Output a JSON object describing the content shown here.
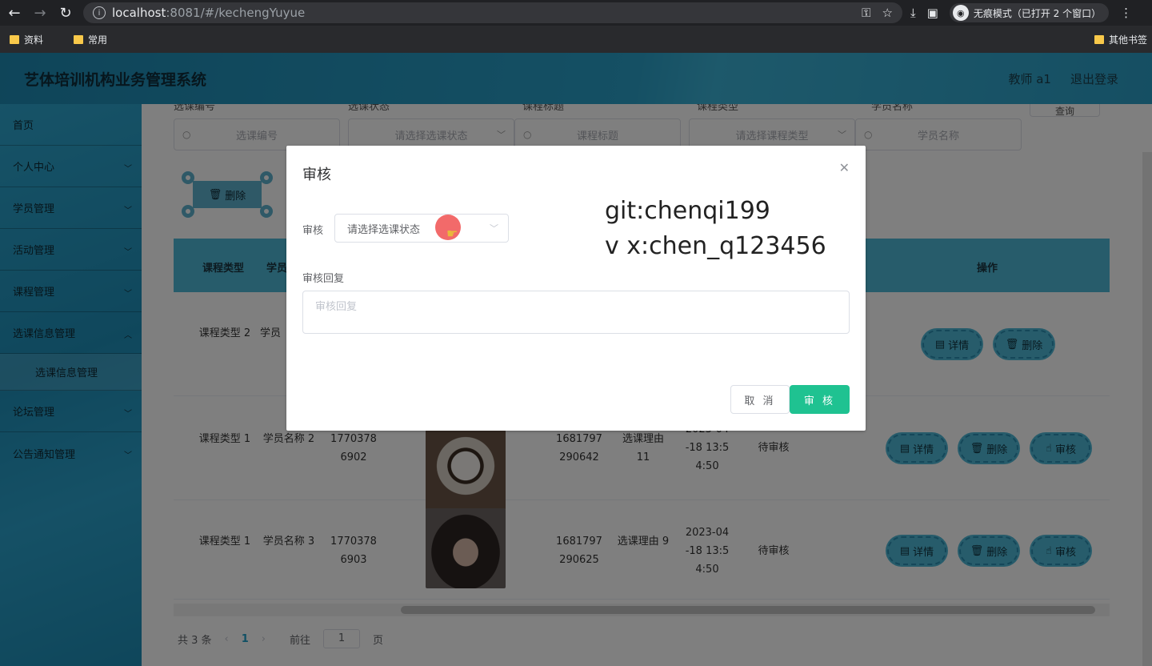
{
  "browser": {
    "url_host": "localhost",
    "url_path": ":8081/#/kechengYuyue",
    "incognito_label": "无痕模式（已打开 2 个窗口）",
    "bookmarks": [
      "资料",
      "常用"
    ],
    "other_bookmarks": "其他书签"
  },
  "header": {
    "title": "艺体培训机构业务管理系统",
    "user": "教师 a1",
    "logout": "退出登录"
  },
  "sidebar": {
    "items": [
      {
        "label": "首页"
      },
      {
        "label": "个人中心"
      },
      {
        "label": "学员管理"
      },
      {
        "label": "活动管理"
      },
      {
        "label": "课程管理"
      },
      {
        "label": "选课信息管理"
      }
    ],
    "sub_item": "选课信息管理",
    "items_after": [
      {
        "label": "论坛管理"
      },
      {
        "label": "公告通知管理"
      }
    ]
  },
  "search": {
    "labels": [
      "选课编号",
      "选课状态",
      "课程标题",
      "课程类型",
      "学员名称"
    ],
    "placeholders": [
      "选课编号",
      "请选择选课状态",
      "课程标题",
      "请选择课程类型",
      "学员名称"
    ],
    "query_label": "查询"
  },
  "toolbar": {
    "bulk_delete": "删除"
  },
  "table": {
    "headers": [
      "课程类型",
      "学员",
      "操作"
    ],
    "rows": [
      {
        "type": "课程类型 2",
        "student": "学员",
        "phone": "",
        "code": "",
        "reason": "",
        "time": "",
        "status": ""
      },
      {
        "type": "课程类型 1",
        "student": "学员名称 2",
        "phone": "1770378 6902",
        "code": "1681797 290642",
        "reason": "选课理由 11",
        "time": "2023-04 -18 13:5 4:50",
        "status": "待审核"
      },
      {
        "type": "课程类型 1",
        "student": "学员名称 3",
        "phone": "1770378 6903",
        "code": "1681797 290625",
        "reason": "选课理由 9",
        "time": "2023-04 -18 13:5 4:50",
        "status": "待审核"
      }
    ],
    "actions": {
      "detail": "详情",
      "delete": "删除",
      "audit": "审核"
    }
  },
  "pager": {
    "total": "共 3 条",
    "current": "1",
    "goto": "前往",
    "page_input": "1",
    "page_unit": "页"
  },
  "dialog": {
    "title": "审核",
    "audit_label": "审核",
    "audit_placeholder": "请选择选课状态",
    "reply_label": "审核回复",
    "reply_placeholder": "审核回复",
    "watermark_line1": "git:chenqi199",
    "watermark_line2": "v x:chen_q123456",
    "cancel": "取 消",
    "ok": "审 核"
  }
}
